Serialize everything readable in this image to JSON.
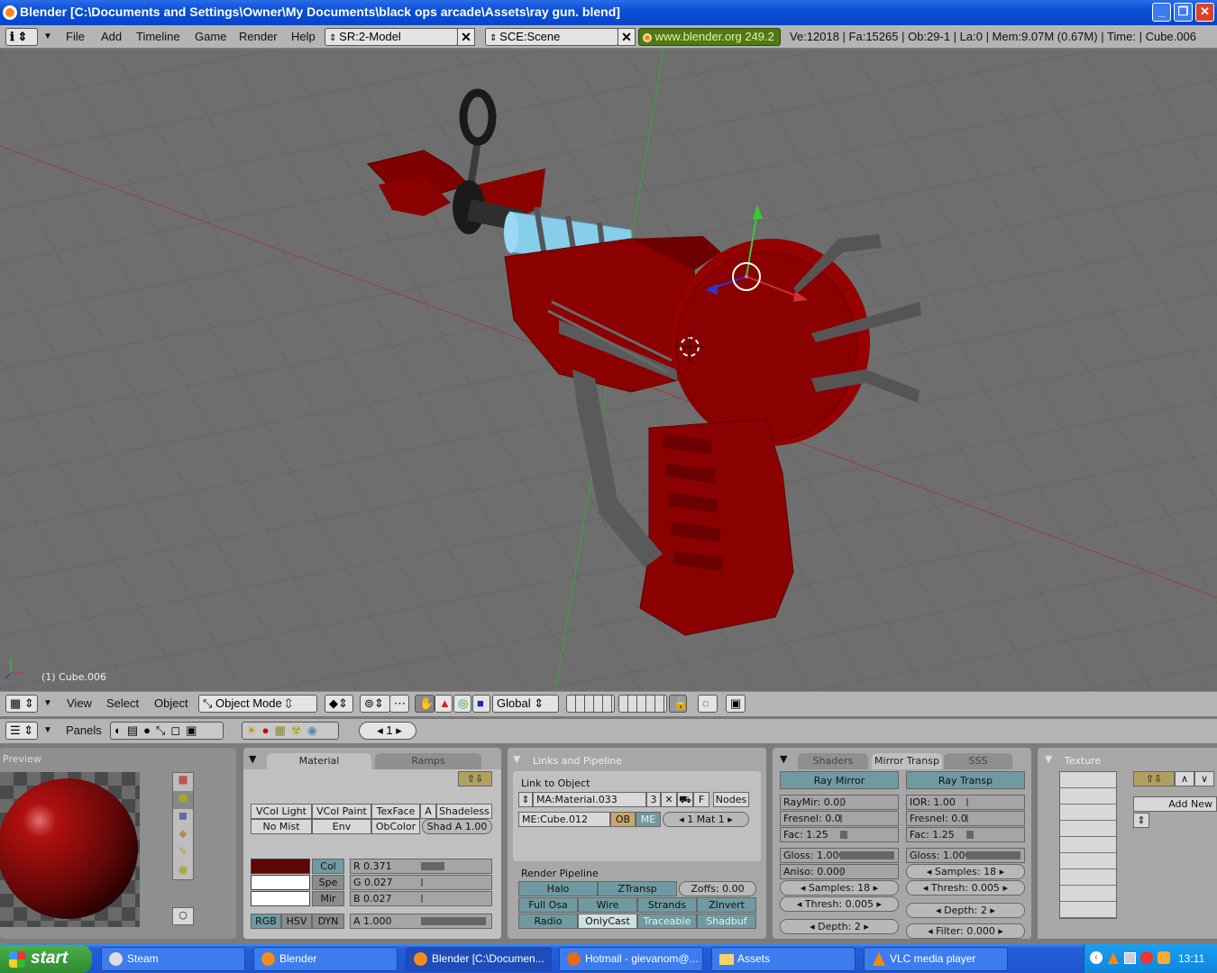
{
  "window": {
    "title": "Blender [C:\\Documents and Settings\\Owner\\My Documents\\black ops arcade\\Assets\\ray gun. blend]",
    "controls": {
      "minimize": "_",
      "maximize": "❐",
      "close": "✕"
    }
  },
  "menubar": {
    "menus": [
      "File",
      "Add",
      "Timeline",
      "Game",
      "Render",
      "Help"
    ],
    "screen": "SR:2-Model",
    "scene": "SCE:Scene",
    "website": "www.blender.org 249.2",
    "stats": "Ve:12018 | Fa:15265 | Ob:29-1 | La:0  | Mem:9.07M (0.67M)  | Time: | Cube.006"
  },
  "viewport": {
    "object_label": "(1) Cube.006",
    "colors": {
      "background": "#6e6e6e",
      "grid": "#5f5f5f",
      "gun_body": "#8b0000",
      "gun_tube": "#87ceeb",
      "metal": "#4a4a4a"
    }
  },
  "view3d_header": {
    "menus": [
      "View",
      "Select",
      "Object"
    ],
    "mode": "Object Mode",
    "orientation": "Global"
  },
  "buttons_header": {
    "label": "Panels",
    "frame": "1"
  },
  "preview_panel": {
    "title": "Preview"
  },
  "material_panel": {
    "tabs": [
      "Material",
      "Ramps"
    ],
    "row1": [
      "VCol Light",
      "VCol Paint",
      "TexFace",
      "A",
      "Shadeless"
    ],
    "row2": [
      "No Mist",
      "Env",
      "ObColor",
      "Shad A 1.00"
    ],
    "color_buttons": [
      "Col",
      "Spe",
      "Mir"
    ],
    "rgb": [
      "R 0.371",
      "G 0.027",
      "B 0.027"
    ],
    "modes": [
      "RGB",
      "HSV",
      "DYN"
    ],
    "alpha": "A 1.000",
    "swatch_color": "#5e0707"
  },
  "links_panel": {
    "title": "Links and Pipeline",
    "link_label": "Link to Object",
    "material": "MA:Material.033",
    "users": "3",
    "f_button": "F",
    "nodes": "Nodes",
    "mesh": "ME:Cube.012",
    "ob": "OB",
    "me": "ME",
    "mat_index": "1 Mat 1",
    "pipeline_label": "Render Pipeline",
    "pipe_row1": [
      "Halo",
      "ZTransp",
      "Zoffs: 0.00"
    ],
    "pipe_row2": [
      "Full Osa",
      "Wire",
      "Strands",
      "ZInvert"
    ],
    "pipe_row3": [
      "Radio",
      "OnlyCast",
      "Traceable",
      "Shadbuf"
    ]
  },
  "mirror_panel": {
    "tabs": [
      "Shaders",
      "Mirror Transp",
      "SSS"
    ],
    "ray_mirror": "Ray Mirror",
    "ray_transp": "Ray Transp",
    "left": [
      "RayMir: 0.00",
      "Fresnel: 0.0",
      "Fac: 1.25",
      "Gloss: 1.000",
      "Aniso: 0.000",
      "Samples: 18",
      "Thresh: 0.005",
      "Depth: 2"
    ],
    "right": [
      "IOR: 1.00",
      "Fresnel: 0.0",
      "Fac: 1.25",
      "Gloss: 1.000",
      "Samples: 18",
      "Thresh: 0.005",
      "Depth: 2",
      "Filter: 0.000"
    ]
  },
  "texture_panel": {
    "title": "Texture",
    "add_new": "Add New"
  },
  "taskbar": {
    "start": "start",
    "tasks": [
      "Steam",
      "Blender",
      "Blender [C:\\Documen...",
      "Hotmail - gievanom@...",
      "Assets",
      "VLC media player"
    ],
    "clock": "13:11"
  }
}
